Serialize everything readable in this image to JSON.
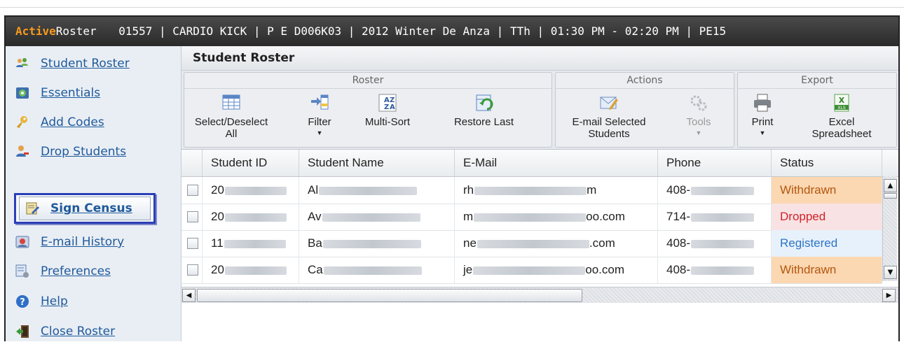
{
  "app": {
    "brand_part1": "Active",
    "brand_part2": "Roster",
    "course_info": "01557 | CARDIO KICK | P E D006K03 | 2012 Winter De Anza | TTh | 01:30 PM - 02:20 PM | PE15"
  },
  "sidebar": {
    "items": [
      {
        "label": "Student Roster",
        "icon": "students-icon"
      },
      {
        "label": "Essentials",
        "icon": "essentials-icon"
      },
      {
        "label": "Add Codes",
        "icon": "key-icon"
      },
      {
        "label": "Drop Students",
        "icon": "drop-user-icon"
      },
      {
        "label": "Sign Census",
        "icon": "sign-document-icon",
        "active": true
      },
      {
        "label": "E-mail History",
        "icon": "email-history-icon"
      },
      {
        "label": "Preferences",
        "icon": "preferences-icon"
      },
      {
        "label": "Help",
        "icon": "help-icon"
      },
      {
        "label": "Close Roster",
        "icon": "exit-door-icon"
      }
    ]
  },
  "panel": {
    "title": "Student Roster"
  },
  "toolbar": {
    "groups": {
      "roster": "Roster",
      "actions": "Actions",
      "export": "Export"
    },
    "select_line1": "Select/Deselect",
    "select_line2": "All",
    "filter": "Filter",
    "multisort": "Multi-Sort",
    "restore": "Restore Last",
    "email_line1": "E-mail Selected",
    "email_line2": "Students",
    "tools": "Tools",
    "print": "Print",
    "excel_line1": "Excel",
    "excel_line2": "Spreadsheet"
  },
  "grid": {
    "columns": [
      "Student ID",
      "Student Name",
      "E-Mail",
      "Phone",
      "Status"
    ],
    "rows": [
      {
        "id": "20",
        "name": "Al",
        "email_start": "rh",
        "email_end": "m",
        "phone": "408-",
        "status": "Withdrawn"
      },
      {
        "id": "20",
        "name": "Av",
        "email_start": "m",
        "email_end": "oo.com",
        "phone": "714-",
        "status": "Dropped"
      },
      {
        "id": "11",
        "name": "Ba",
        "email_start": "ne",
        "email_end": ".com",
        "phone": "408-",
        "status": "Registered"
      },
      {
        "id": "20",
        "name": "Ca",
        "email_start": "je",
        "email_end": "oo.com",
        "phone": "408-",
        "status": "Withdrawn"
      }
    ]
  },
  "colors": {
    "title_bar": "#2f2f2f",
    "brand_accent": "#f59a1e",
    "active_nav_border": "#2a3fb6",
    "status_withdrawn_bg": "#fbd7b2",
    "status_dropped_text": "#d0232a",
    "status_registered_text": "#2d74c4"
  }
}
